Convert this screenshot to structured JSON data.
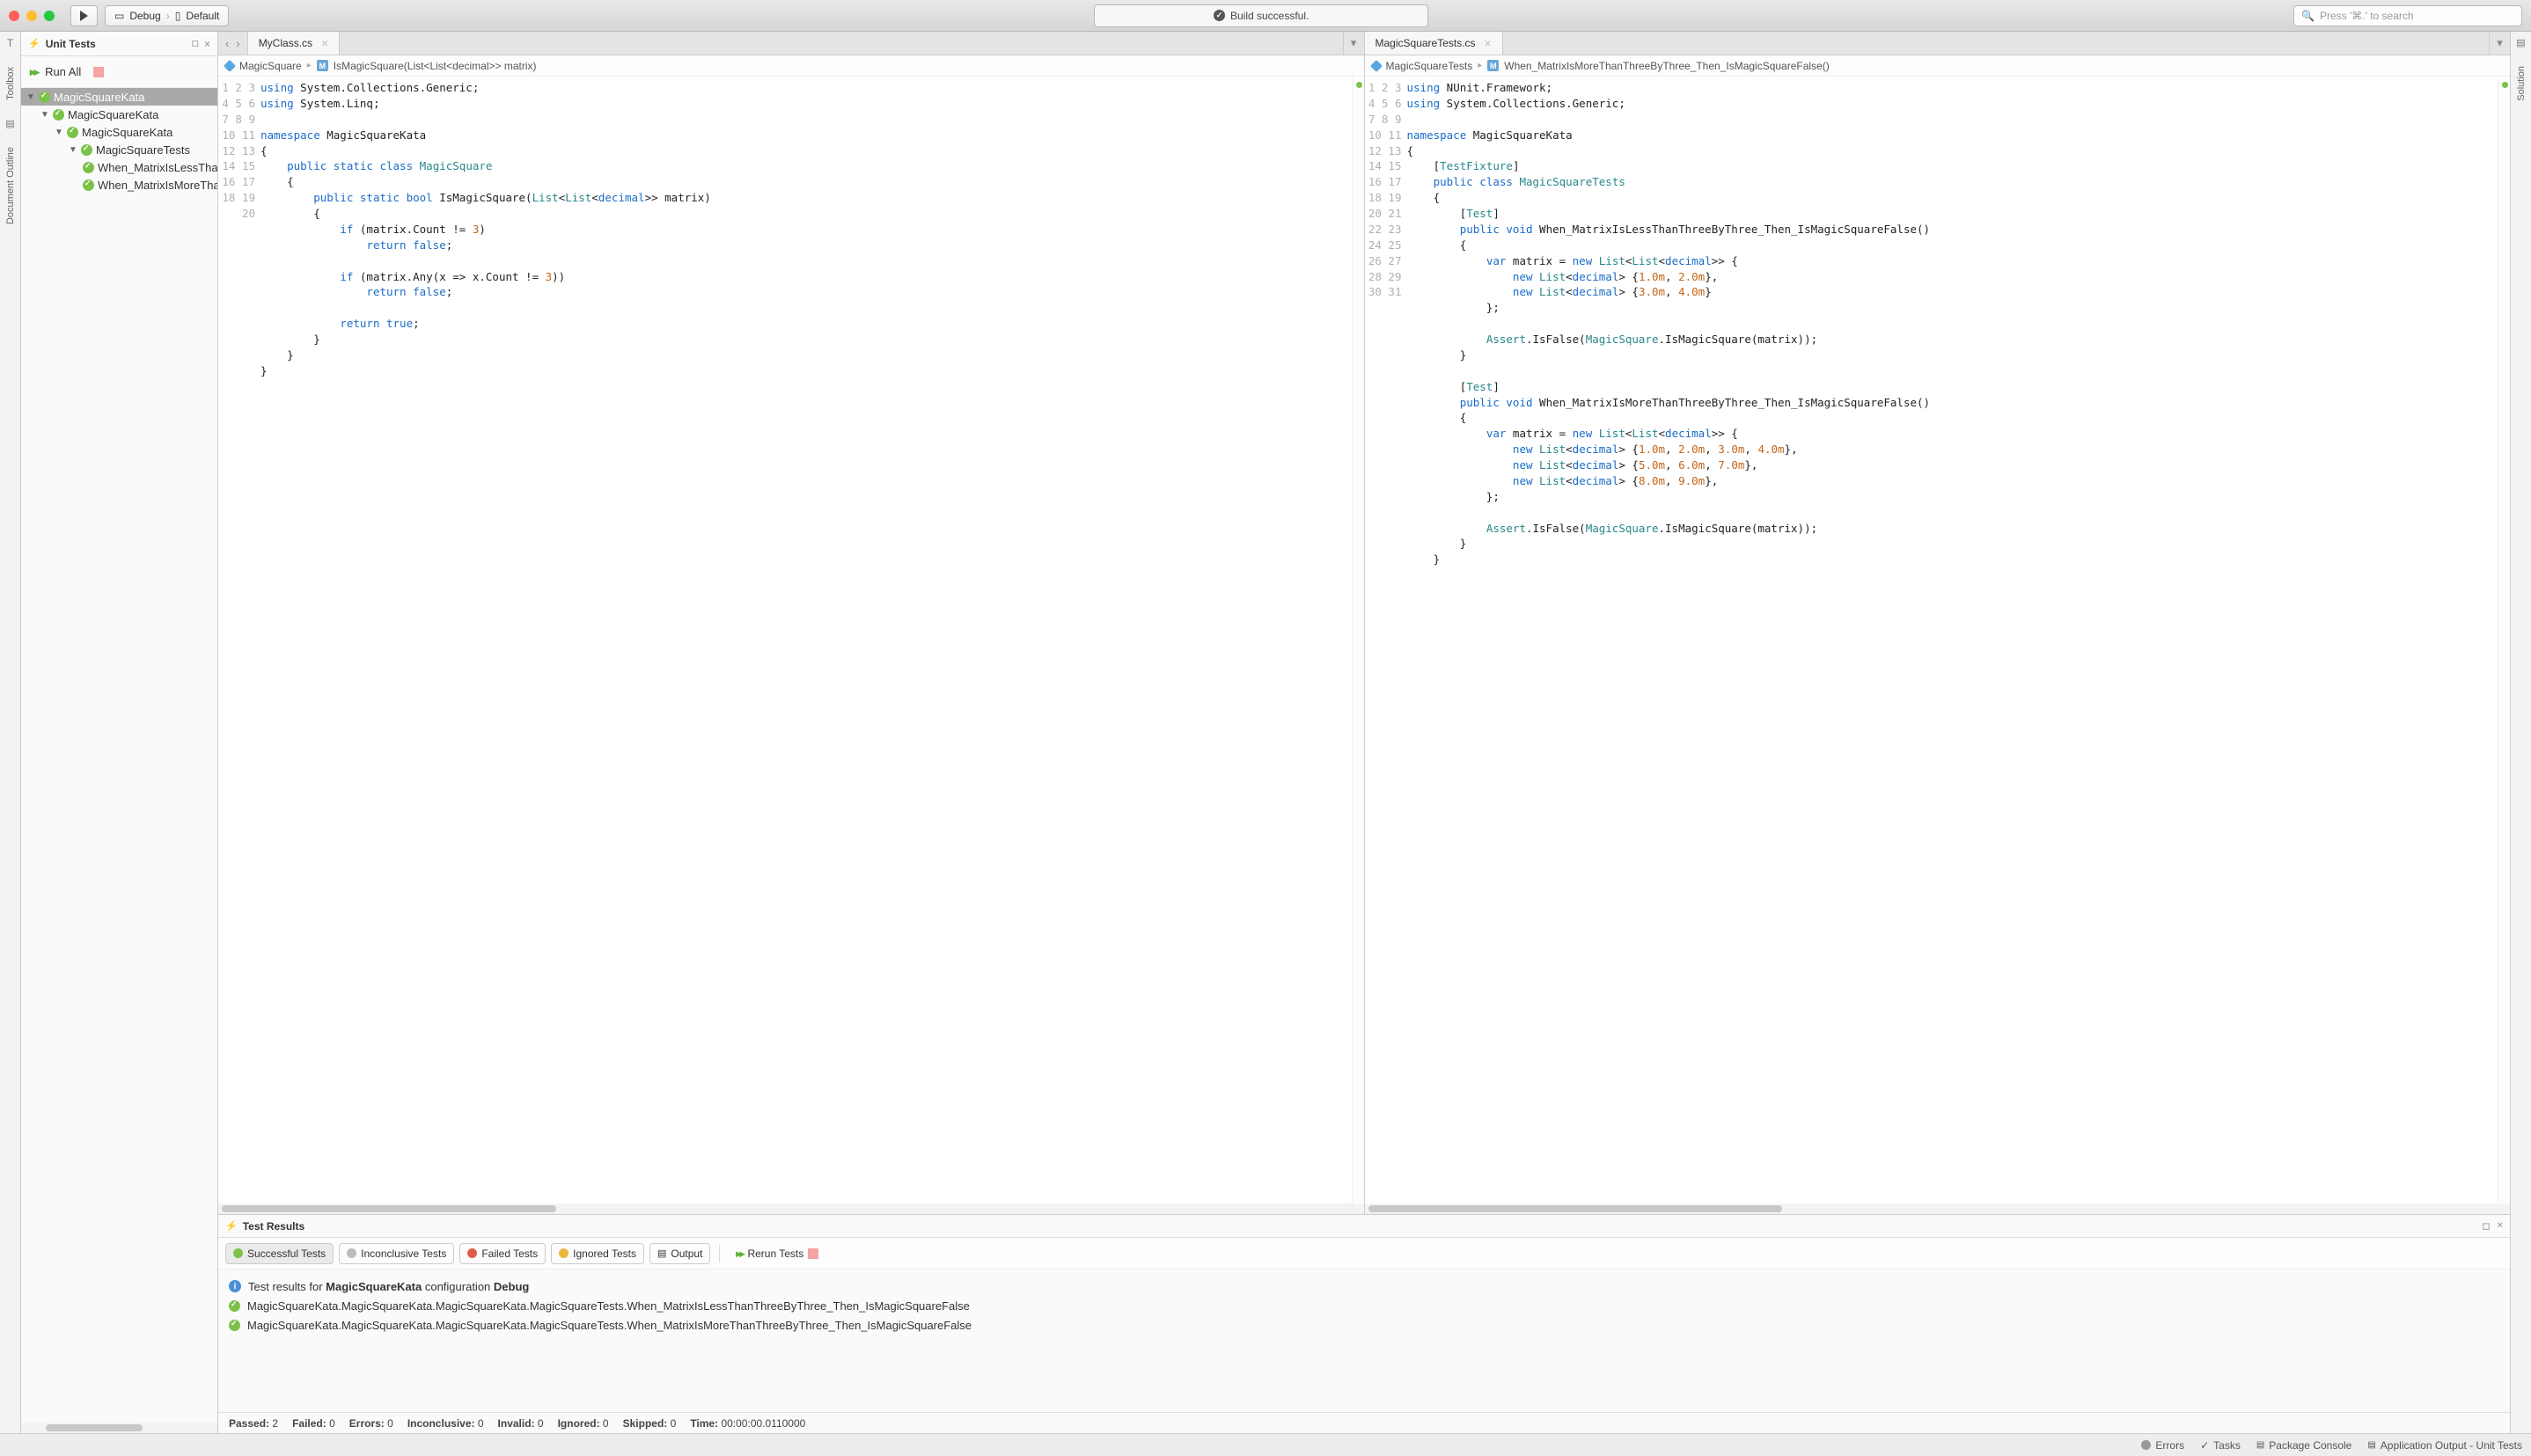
{
  "toolbar": {
    "config_label": "Debug",
    "target_label": "Default",
    "build_status": "Build successful.",
    "search_placeholder": "Press '⌘.' to search"
  },
  "left_rail": {
    "toolbox": "Toolbox",
    "doc_outline": "Document Outline"
  },
  "right_rail": {
    "solution": "Solution"
  },
  "unit_tests": {
    "title": "Unit Tests",
    "run_all": "Run All",
    "nodes": {
      "root": "MagicSquareKata",
      "child1": "MagicSquareKata",
      "child2": "MagicSquareKata",
      "child3": "MagicSquareTests",
      "t1": "When_MatrixIsLessThanThreeByThree_Then_IsMagicSquareFalse",
      "t2": "When_MatrixIsMoreThanThreeByThree_Then_IsMagicSquareFalse"
    }
  },
  "editor_left": {
    "tab": "MyClass.cs",
    "breadcrumb": {
      "ns": "MagicSquare",
      "member": "IsMagicSquare(List<List<decimal>> matrix)"
    },
    "code_lines": 20
  },
  "editor_right": {
    "tab": "MagicSquareTests.cs",
    "breadcrumb": {
      "ns": "MagicSquareTests",
      "member": "When_MatrixIsMoreThanThreeByThree_Then_IsMagicSquareFalse()"
    },
    "code_lines": 31
  },
  "test_results": {
    "title": "Test Results",
    "filters": {
      "successful": "Successful Tests",
      "inconclusive": "Inconclusive Tests",
      "failed": "Failed Tests",
      "ignored": "Ignored Tests",
      "output": "Output",
      "rerun": "Rerun Tests"
    },
    "summary_prefix": "Test results for ",
    "summary_project": "MagicSquareKata",
    "summary_mid": " configuration ",
    "summary_config": "Debug",
    "rows": [
      "MagicSquareKata.MagicSquareKata.MagicSquareKata.MagicSquareTests.When_MatrixIsLessThanThreeByThree_Then_IsMagicSquareFalse",
      "MagicSquareKata.MagicSquareKata.MagicSquareKata.MagicSquareTests.When_MatrixIsMoreThanThreeByThree_Then_IsMagicSquareFalse"
    ],
    "status": {
      "passed_label": "Passed:",
      "passed": "2",
      "failed_label": "Failed:",
      "failed": "0",
      "errors_label": "Errors:",
      "errors": "0",
      "inconclusive_label": "Inconclusive:",
      "inconclusive": "0",
      "invalid_label": "Invalid:",
      "invalid": "0",
      "ignored_label": "Ignored:",
      "ignored": "0",
      "skipped_label": "Skipped:",
      "skipped": "0",
      "time_label": "Time:",
      "time": "00:00:00.0110000"
    }
  },
  "footer": {
    "errors": "Errors",
    "tasks": "Tasks",
    "package_console": "Package Console",
    "app_output": "Application Output - Unit Tests"
  }
}
